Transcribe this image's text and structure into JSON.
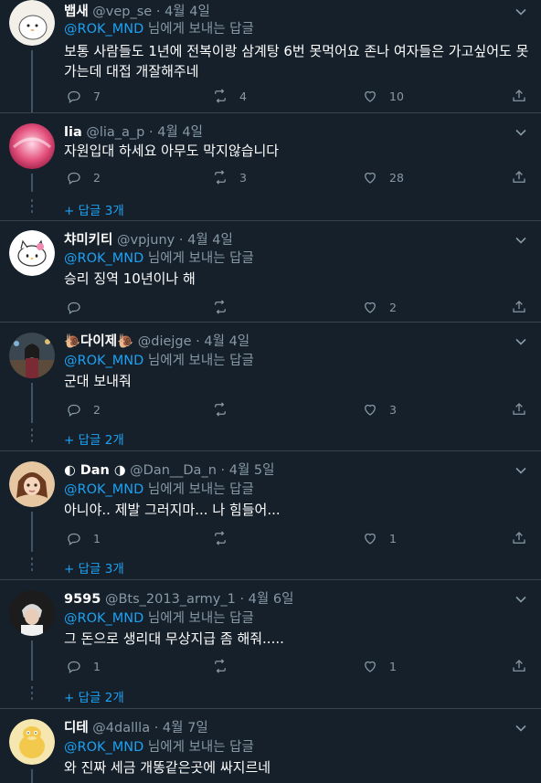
{
  "labels": {
    "replying_to": "님에게 보내는 답글",
    "mention": "@ROK_MND"
  },
  "colors": {
    "background": "#15202b",
    "accent": "#1da1f2",
    "muted": "#8899a6",
    "divider": "#38444d"
  },
  "tweets": [
    {
      "name": "뱁새",
      "handle": "@vep_se",
      "date": "4월 4일",
      "show_reply_to": true,
      "text": "보통 사람들도 1년에 전복이랑 삼계탕 6번 못먹어요 존나 여자들은 가고싶어도 못가는데 대접 개잘해주네",
      "replies": "7",
      "retweets": "4",
      "likes": "10",
      "more_replies": ""
    },
    {
      "name": "lia",
      "handle": "@lia_a_p",
      "date": "4월 4일",
      "show_reply_to": false,
      "text": "자원입대 하세요 아무도 막지않습니다",
      "replies": "2",
      "retweets": "3",
      "likes": "28",
      "more_replies": "+ 답글 3개"
    },
    {
      "name": "챠미키티",
      "handle": "@vpjuny",
      "date": "4월 4일",
      "show_reply_to": true,
      "text": "승리 징역 10년이나 해",
      "replies": "",
      "retweets": "",
      "likes": "2",
      "more_replies": ""
    },
    {
      "name": "🐌다이제🐌",
      "handle": "@diejge",
      "date": "4월 4일",
      "show_reply_to": true,
      "text": "군대 보내줘",
      "replies": "2",
      "retweets": "",
      "likes": "3",
      "more_replies": "+ 답글 2개"
    },
    {
      "name": "◐ Dan ◑",
      "handle": "@Dan__Da_n",
      "date": "4월 5일",
      "show_reply_to": true,
      "text": "아니야.. 제발 그러지마... 나 힘들어...",
      "replies": "1",
      "retweets": "",
      "likes": "1",
      "more_replies": "+ 답글 3개"
    },
    {
      "name": "9595",
      "handle": "@Bts_2013_army_1",
      "date": "4월 6일",
      "show_reply_to": true,
      "text": "그 돈으로 생리대 무상지급 좀 해줘.....",
      "replies": "1",
      "retweets": "",
      "likes": "1",
      "more_replies": "+ 답글 2개"
    },
    {
      "name": "디테",
      "handle": "@4dallla",
      "date": "4월 7일",
      "show_reply_to": true,
      "text": "와 진짜 세금 개똥같은곳에 싸지르네",
      "replies": "",
      "retweets": "",
      "likes": "",
      "more_replies": ""
    }
  ]
}
